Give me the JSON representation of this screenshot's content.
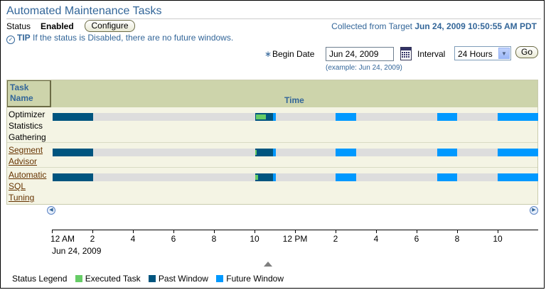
{
  "page": {
    "title": "Automated Maintenance Tasks",
    "status_label": "Status",
    "status_value": "Enabled",
    "configure_label": "Configure",
    "collected_prefix": "Collected from Target",
    "collected_time": "Jun 24, 2009 10:50:55 AM PDT",
    "tip_label": "TIP",
    "tip_text": "If the status is Disabled, there are no future windows."
  },
  "form": {
    "required_marker": "∗",
    "begin_date_label": "Begin Date",
    "begin_date_value": "Jun 24, 2009",
    "example_text": "(example: Jun 24, 2009)",
    "interval_label": "Interval",
    "interval_value": "24 Hours",
    "go_label": "Go"
  },
  "table": {
    "col_task": "Task Name",
    "col_time": "Time",
    "rows": [
      {
        "name": "Optimizer Statistics Gathering",
        "link": false
      },
      {
        "name": "Segment Advisor",
        "link": true
      },
      {
        "name": "Automatic SQL Tuning",
        "link": true
      }
    ]
  },
  "chart_data": {
    "type": "gantt",
    "x_unit": "hours since 12 AM Jun 24, 2009",
    "xlim": [
      0,
      24
    ],
    "ticks": [
      "12 AM",
      "2",
      "4",
      "6",
      "8",
      "10",
      "12 PM",
      "2",
      "4",
      "6",
      "8",
      "10"
    ],
    "tick_hours": [
      0,
      2,
      4,
      6,
      8,
      10,
      12,
      14,
      16,
      18,
      20,
      22
    ],
    "date_label": "Jun 24, 2009",
    "series": [
      {
        "task": "Optimizer Statistics Gathering",
        "windows": [
          {
            "kind": "past",
            "start": 0,
            "end": 2
          },
          {
            "kind": "past",
            "start": 10,
            "end": 10.9
          },
          {
            "kind": "future",
            "start": 10.9,
            "end": 11.05
          },
          {
            "kind": "future",
            "start": 14,
            "end": 15
          },
          {
            "kind": "future",
            "start": 19,
            "end": 20
          },
          {
            "kind": "future",
            "start": 22,
            "end": 24
          }
        ],
        "executed": [
          {
            "start": 10.05,
            "end": 10.55
          }
        ]
      },
      {
        "task": "Segment Advisor",
        "windows": [
          {
            "kind": "past",
            "start": 0,
            "end": 2
          },
          {
            "kind": "past",
            "start": 10,
            "end": 10.9
          },
          {
            "kind": "future",
            "start": 10.9,
            "end": 11.05
          },
          {
            "kind": "future",
            "start": 14,
            "end": 15
          },
          {
            "kind": "future",
            "start": 19,
            "end": 20
          },
          {
            "kind": "future",
            "start": 22,
            "end": 24
          }
        ],
        "executed": [
          {
            "start": 10,
            "end": 10.03
          }
        ]
      },
      {
        "task": "Automatic SQL Tuning",
        "windows": [
          {
            "kind": "past",
            "start": 0,
            "end": 2
          },
          {
            "kind": "past",
            "start": 10,
            "end": 10.9
          },
          {
            "kind": "future",
            "start": 10.9,
            "end": 11.05
          },
          {
            "kind": "future",
            "start": 14,
            "end": 15
          },
          {
            "kind": "future",
            "start": 19,
            "end": 20
          },
          {
            "kind": "future",
            "start": 22,
            "end": 24
          }
        ],
        "executed": [
          {
            "start": 10,
            "end": 10.15
          }
        ]
      }
    ],
    "colors": {
      "executed": "#66cc66",
      "past": "#00557f",
      "future": "#0099ff",
      "empty": "#dddddd"
    }
  },
  "legend": {
    "label": "Status Legend",
    "items": [
      "Executed Task",
      "Past Window",
      "Future Window"
    ]
  }
}
